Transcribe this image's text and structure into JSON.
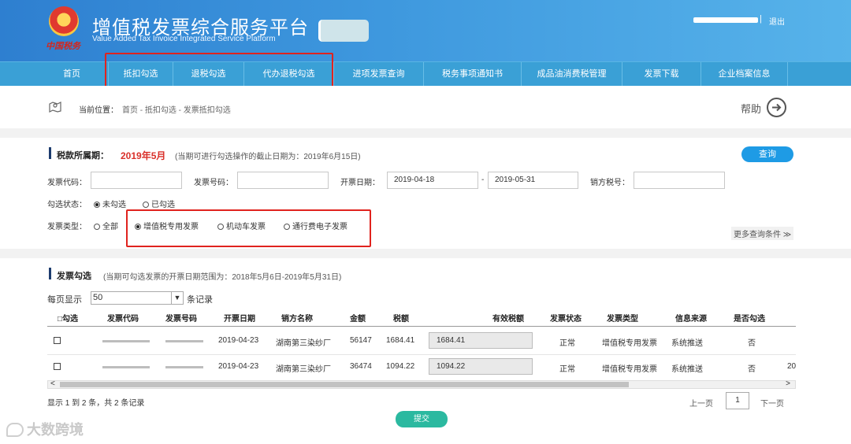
{
  "header": {
    "title_cn": "增值税发票综合服务平台",
    "title_en": "Value Added Tax Invoice Integrated Service Platform",
    "logo_text": "中国税务",
    "logout": "退出",
    "separator": "|"
  },
  "nav": {
    "items": [
      {
        "label": "首页"
      },
      {
        "label": "抵扣勾选"
      },
      {
        "label": "退税勾选"
      },
      {
        "label": "代办退税勾选"
      },
      {
        "label": "进项发票查询"
      },
      {
        "label": "税务事项通知书"
      },
      {
        "label": "成品油消费税管理"
      },
      {
        "label": "发票下载"
      },
      {
        "label": "企业档案信息"
      }
    ]
  },
  "breadcrumb": {
    "label": "当前位置：",
    "path": "首页 - 抵扣勾选 - 发票抵扣勾选",
    "help": "帮助"
  },
  "filter": {
    "title": "税款所属期：",
    "period": "2019年5月",
    "deadline_note": "(当期可进行勾选操作的截止日期为：2019年6月15日)",
    "query_button": "查询",
    "invoice_code_label": "发票代码：",
    "invoice_code_value": "",
    "invoice_number_label": "发票号码：",
    "invoice_number_value": "",
    "issue_date_label": "开票日期：",
    "date_from": "2019-04-18",
    "date_sep": "-",
    "date_to": "2019-05-31",
    "seller_tax_label": "销方税号：",
    "seller_tax_value": "",
    "check_status_label": "勾选状态：",
    "check_status_options": [
      "未勾选",
      "已勾选"
    ],
    "check_status_selected": "未勾选",
    "invoice_type_label": "发票类型：",
    "invoice_type_options": [
      "全部",
      "增值税专用发票",
      "机动车发票",
      "通行费电子发票"
    ],
    "invoice_type_selected": "增值税专用发票",
    "more_conditions": "更多查询条件 ≫"
  },
  "invoice_section": {
    "title": "发票勾选",
    "note": "(当期可勾选发票的开票日期范围为：2018年5月6日-2019年5月31日)",
    "per_page_label": "每页显示",
    "per_page_value": "50",
    "records_label": "条记录",
    "columns": [
      "□勾选",
      "发票代码",
      "发票号码",
      "开票日期",
      "销方名称",
      "金额",
      "税额",
      "有效税额",
      "发票状态",
      "发票类型",
      "信息来源",
      "是否勾选"
    ],
    "rows": [
      {
        "date": "2019-04-23",
        "seller": "湖南第三染纱厂",
        "amount": "56147",
        "tax": "1684.41",
        "effective_tax": "1684.41",
        "status": "正常",
        "type": "增值税专用发票",
        "source": "系统推送",
        "checked": "否",
        "extra": ""
      },
      {
        "date": "2019-04-23",
        "seller": "湖南第三染纱厂",
        "amount": "36474",
        "tax": "1094.22",
        "effective_tax": "1094.22",
        "status": "正常",
        "type": "增值税专用发票",
        "source": "系统推送",
        "checked": "否",
        "extra": "20"
      }
    ],
    "page_info": "显示 1 到 2 条，共 2 条记录",
    "prev": "上一页",
    "page": "1",
    "next": "下一页",
    "submit": "提交"
  },
  "watermark": "大数跨境",
  "colors": {
    "header_start": "#2e7fd0",
    "nav_bg": "#3aa0d6",
    "highlight_box": "#e0231e",
    "period_red": "#d9302a",
    "query_button": "#1e9be5",
    "submit_button": "#2bb9a0"
  }
}
